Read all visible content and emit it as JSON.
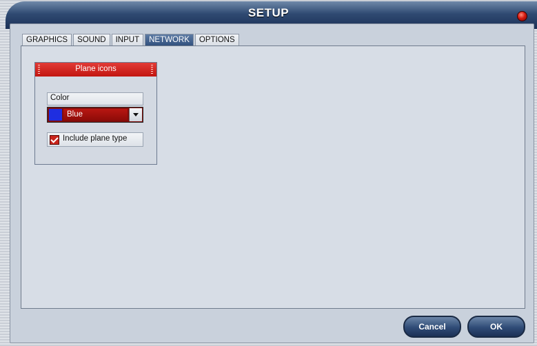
{
  "window": {
    "title": "SETUP"
  },
  "tabs": [
    {
      "label": "GRAPHICS",
      "active": false
    },
    {
      "label": "SOUND",
      "active": false
    },
    {
      "label": "INPUT",
      "active": false
    },
    {
      "label": "NETWORK",
      "active": true
    },
    {
      "label": "OPTIONS",
      "active": false
    }
  ],
  "plane_icons": {
    "title": "Plane icons",
    "color_label": "Color",
    "color_value": "Blue",
    "swatch_color": "#1f2ee0",
    "include_type_label": "Include plane type",
    "include_type_checked": true
  },
  "buttons": {
    "cancel": "Cancel",
    "ok": "OK"
  },
  "colors": {
    "accent_red": "#c21510",
    "title_blue": "#2f4a72"
  }
}
